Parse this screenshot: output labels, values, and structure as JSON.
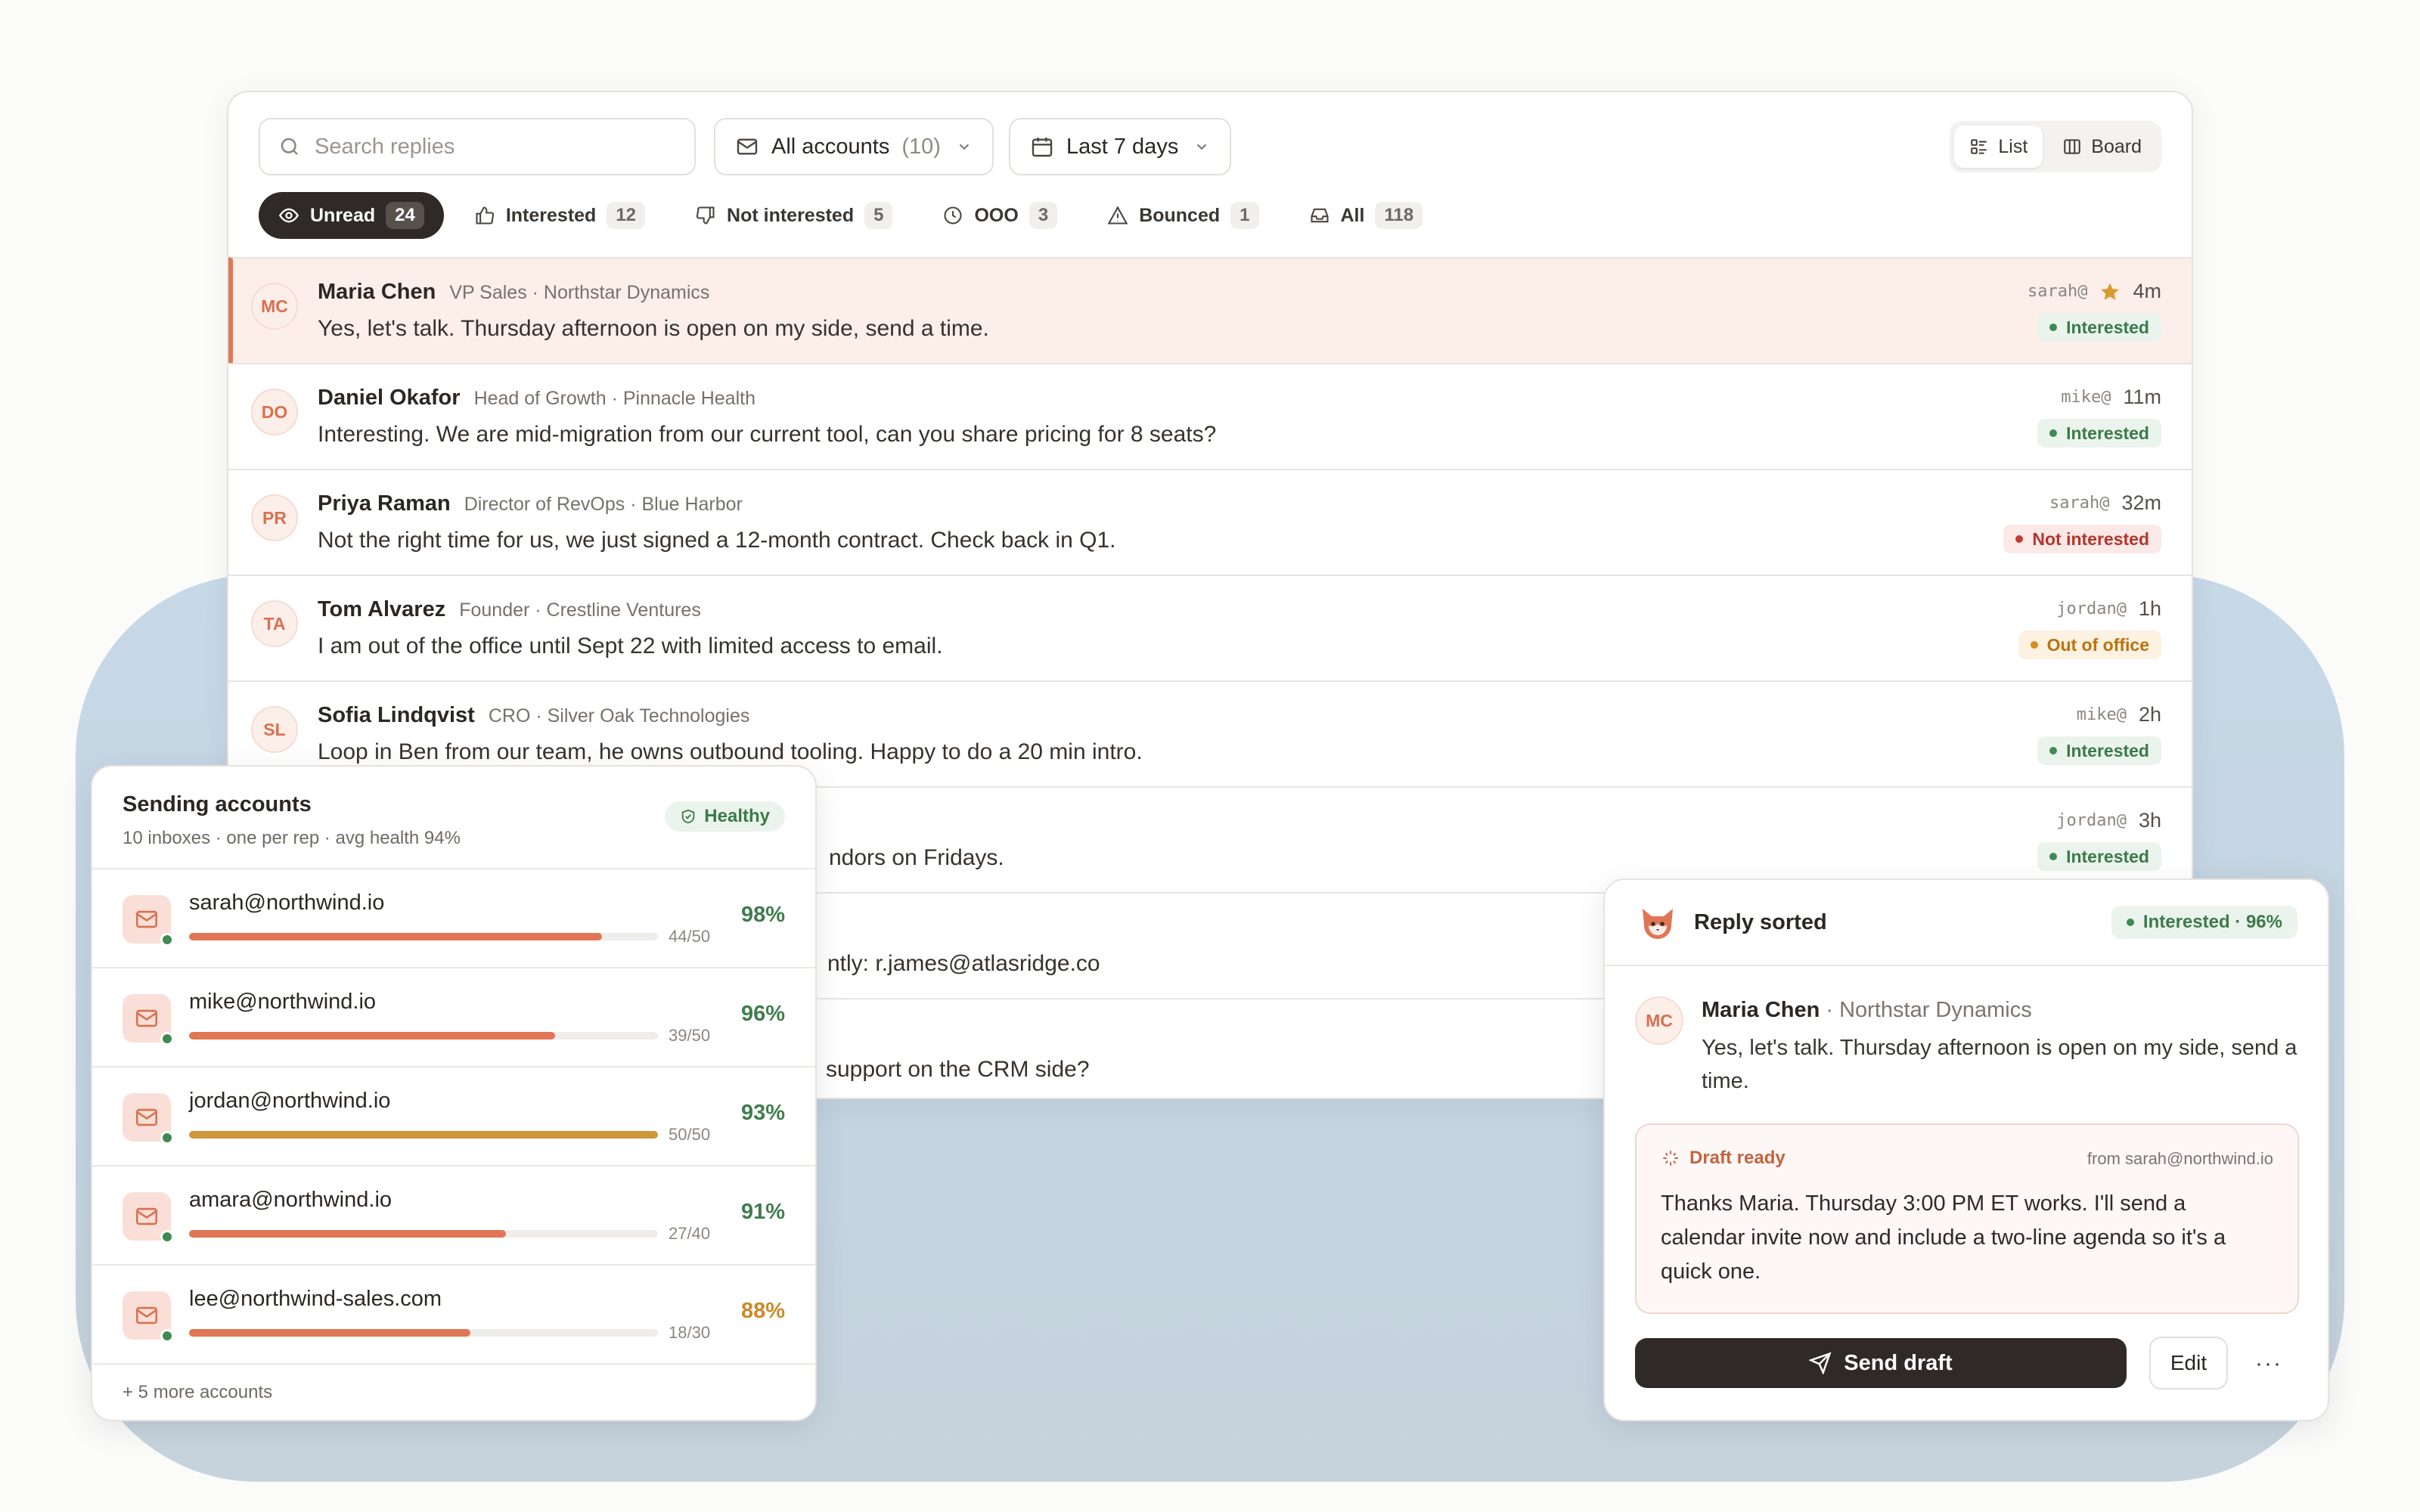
{
  "toolbar": {
    "search_placeholder": "Search replies",
    "accounts_label": "All accounts",
    "accounts_count": "(10)",
    "date_label": "Last 7 days",
    "view_list": "List",
    "view_board": "Board"
  },
  "filters": [
    {
      "label": "Unread",
      "count": "24",
      "icon": "eye-icon",
      "active": true
    },
    {
      "label": "Interested",
      "count": "12",
      "icon": "thumbs-up-icon"
    },
    {
      "label": "Not interested",
      "count": "5",
      "icon": "thumbs-down-icon"
    },
    {
      "label": "OOO",
      "count": "3",
      "icon": "clock-icon"
    },
    {
      "label": "Bounced",
      "count": "1",
      "icon": "warning-icon"
    },
    {
      "label": "All",
      "count": "118",
      "icon": "inbox-icon"
    }
  ],
  "replies": [
    {
      "initials": "MC",
      "name": "Maria Chen",
      "title": "VP Sales · Northstar Dynamics",
      "message": "Yes, let's talk. Thursday afternoon is open on my side, send a time.",
      "inbox": "sarah@",
      "time": "4m",
      "status": "Interested",
      "starred": true
    },
    {
      "initials": "DO",
      "name": "Daniel Okafor",
      "title": "Head of Growth · Pinnacle Health",
      "message": "Interesting. We are mid-migration from our current tool, can you share pricing for 8 seats?",
      "inbox": "mike@",
      "time": "11m",
      "status": "Interested"
    },
    {
      "initials": "PR",
      "name": "Priya Raman",
      "title": "Director of RevOps · Blue Harbor",
      "message": "Not the right time for us, we just signed a 12-month contract. Check back in Q1.",
      "inbox": "sarah@",
      "time": "32m",
      "status": "Not interested"
    },
    {
      "initials": "TA",
      "name": "Tom Alvarez",
      "title": "Founder · Crestline Ventures",
      "message": "I am out of the office until Sept 22 with limited access to email.",
      "inbox": "jordan@",
      "time": "1h",
      "status": "Out of office"
    },
    {
      "initials": "SL",
      "name": "Sofia Lindqvist",
      "title": "CRO · Silver Oak Technologies",
      "message": "Loop in Ben from our team, he owns outbound tooling. Happy to do a 20 min intro.",
      "inbox": "mike@",
      "time": "2h",
      "status": "Interested"
    },
    {
      "initials": "",
      "name": "",
      "title": "",
      "message": "ndors on Fridays.",
      "inbox": "jordan@",
      "time": "3h",
      "status": "Interested"
    },
    {
      "initials": "",
      "name": "",
      "title": "",
      "message": "ntly: r.james@atlasridge.co",
      "inbox": "",
      "time": "",
      "status": ""
    },
    {
      "initials": "",
      "name": "",
      "title": "",
      "message": "support on the CRM side?",
      "inbox": "",
      "time": "",
      "status": ""
    }
  ],
  "accounts": {
    "title": "Sending accounts",
    "subtitle": "10 inboxes · one per rep · avg health 94%",
    "health_badge": "Healthy",
    "items": [
      {
        "email": "sarah@northwind.io",
        "sent": "44/50",
        "fill": 0.88,
        "health": "98%",
        "bar_color": "#e07656",
        "pct_color": "#3f7d4d"
      },
      {
        "email": "mike@northwind.io",
        "sent": "39/50",
        "fill": 0.78,
        "health": "96%",
        "bar_color": "#e07656",
        "pct_color": "#3f7d4d"
      },
      {
        "email": "jordan@northwind.io",
        "sent": "50/50",
        "fill": 1.0,
        "health": "93%",
        "bar_color": "#d0963a",
        "pct_color": "#3f7d4d"
      },
      {
        "email": "amara@northwind.io",
        "sent": "27/40",
        "fill": 0.675,
        "health": "91%",
        "bar_color": "#e07656",
        "pct_color": "#3f7d4d"
      },
      {
        "email": "lee@northwind-sales.com",
        "sent": "18/30",
        "fill": 0.6,
        "health": "88%",
        "bar_color": "#e07656",
        "pct_color": "#c98a2a"
      }
    ],
    "more": "+ 5 more accounts"
  },
  "reply_card": {
    "title": "Reply sorted",
    "badge": "Interested · 96%",
    "initials": "MC",
    "from_name": "Maria Chen",
    "from_company": "· Northstar Dynamics",
    "message": "Yes, let's talk. Thursday afternoon is open on my side, send a time.",
    "draft_label": "Draft ready",
    "draft_from": "from sarah@northwind.io",
    "draft_text": "Thanks Maria. Thursday 3:00 PM ET works. I'll send a calendar invite now and include a two-line agenda so it's a quick one.",
    "send_label": "Send draft",
    "edit_label": "Edit",
    "more_label": "···"
  },
  "colors": {
    "accent": "#e07656",
    "dark": "#2f2a27",
    "interested": "#3f8a52",
    "not_interested": "#c33d34",
    "ooo": "#d98c1c",
    "backdrop": "#c7d8e6"
  }
}
